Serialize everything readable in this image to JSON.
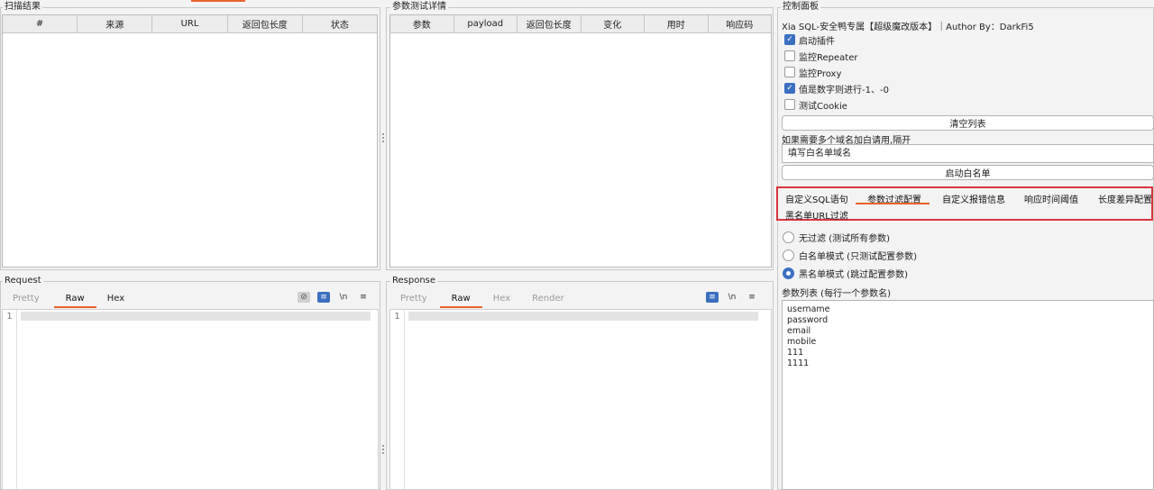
{
  "scan_results": {
    "title": "扫描结果",
    "columns": [
      "#",
      "来源",
      "URL",
      "返回包长度",
      "状态"
    ]
  },
  "param_details": {
    "title": "参数测试详情",
    "columns": [
      "参数",
      "payload",
      "返回包长度",
      "变化",
      "用时",
      "响应码"
    ]
  },
  "request": {
    "title": "Request",
    "tabs": [
      "Pretty",
      "Raw",
      "Hex"
    ],
    "active_tab": "Raw",
    "line_number": "1",
    "icons": [
      "eye-off-icon",
      "wrap-icon",
      "newline-icon",
      "menu-icon"
    ],
    "newline_label": "\\n",
    "menu_glyph": "≡"
  },
  "response": {
    "title": "Response",
    "tabs": [
      "Pretty",
      "Raw",
      "Hex",
      "Render"
    ],
    "active_tab": "Raw",
    "line_number": "1",
    "icons": [
      "wrap-icon",
      "newline-icon",
      "menu-icon"
    ],
    "newline_label": "\\n",
    "menu_glyph": "≡"
  },
  "control": {
    "title": "控制面板",
    "header": "Xia SQL-安全鸭专属【超级魔改版本】｜Author By：DarkFi5",
    "checkboxes": [
      {
        "label": "启动插件",
        "checked": true
      },
      {
        "label": "监控Repeater",
        "checked": false
      },
      {
        "label": "监控Proxy",
        "checked": false
      },
      {
        "label": "值是数字则进行-1、-0",
        "checked": true
      },
      {
        "label": "测试Cookie",
        "checked": false
      }
    ],
    "clear_button": "清空列表",
    "whitelist_hint": "如果需要多个域名加白请用,隔开",
    "whitelist_input": "填写白名单域名",
    "whitelist_button": "启动白名单",
    "config_tabs": [
      "自定义SQL语句",
      "参数过滤配置",
      "自定义报错信息",
      "响应时间阈值",
      "长度差异配置",
      "黑名单URL过滤"
    ],
    "active_config_tab": "参数过滤配置",
    "filter_modes": [
      {
        "label": "无过滤 (测试所有参数)",
        "selected": false
      },
      {
        "label": "白名单模式 (只测试配置参数)",
        "selected": false
      },
      {
        "label": "黑名单模式 (跳过配置参数)",
        "selected": true
      }
    ],
    "param_list_label": "参数列表 (每行一个参数名)",
    "param_list": [
      "username",
      "password",
      "email",
      "mobile",
      "111",
      "1111"
    ]
  },
  "colors": {
    "accent": "#e8622c",
    "highlight_border": "#d9363e",
    "check_blue": "#3b6fc0"
  }
}
